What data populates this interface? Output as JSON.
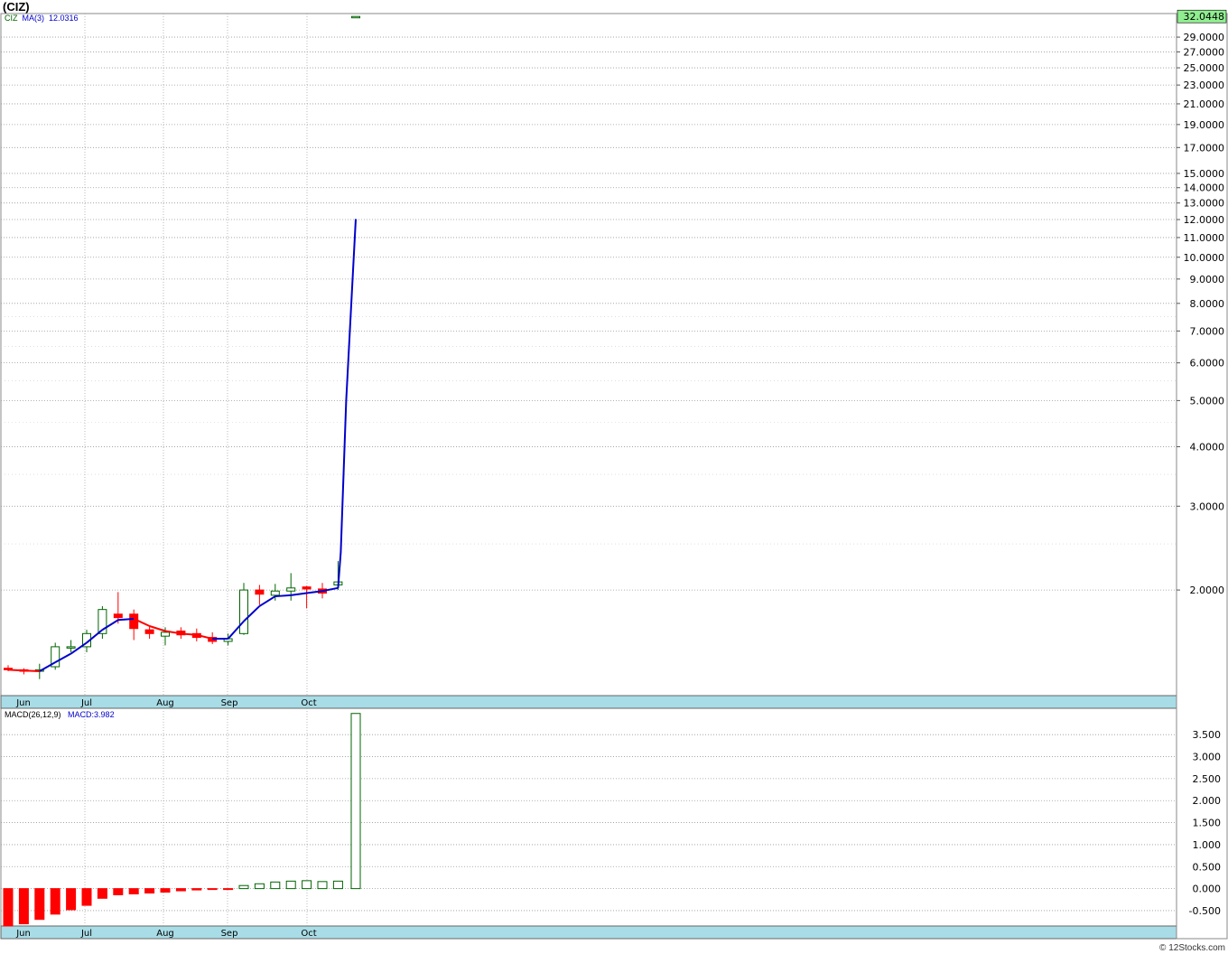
{
  "title": "(CIZ)",
  "credit": "© 12Stocks.com",
  "colors": {
    "up": "#006400",
    "down": "#ff0000",
    "ma_up": "#0000cc",
    "ma_down": "#ff0000",
    "axis_band": "#a8dce6",
    "last_price_bg": "#90ee90"
  },
  "chart_data": [
    {
      "type": "candlestick",
      "symbol": "CIZ",
      "scale": "log",
      "ylim": [
        1.2,
        32.5
      ],
      "x_labels": [
        "Jun",
        "Jul",
        "Aug",
        "Sep",
        "Oct"
      ],
      "y_ticks": [
        "29.0000",
        "27.0000",
        "25.0000",
        "23.0000",
        "21.0000",
        "19.0000",
        "17.0000",
        "15.0000",
        "14.0000",
        "13.0000",
        "12.0000",
        "11.0000",
        "10.0000",
        "9.0000",
        "8.0000",
        "7.0000",
        "6.0000",
        "5.0000",
        "4.0000",
        "3.0000",
        "2.0000"
      ],
      "last_price": "32.0448",
      "legend_symbol": "CIZ",
      "ma_label": "MA(3)",
      "ma_value": "12.0316",
      "candles": [
        {
          "o": 1.37,
          "h": 1.39,
          "l": 1.35,
          "c": 1.36
        },
        {
          "o": 1.36,
          "h": 1.37,
          "l": 1.33,
          "c": 1.35
        },
        {
          "o": 1.35,
          "h": 1.4,
          "l": 1.3,
          "c": 1.36
        },
        {
          "o": 1.38,
          "h": 1.55,
          "l": 1.36,
          "c": 1.52
        },
        {
          "o": 1.52,
          "h": 1.57,
          "l": 1.48,
          "c": 1.52
        },
        {
          "o": 1.52,
          "h": 1.65,
          "l": 1.48,
          "c": 1.62
        },
        {
          "o": 1.62,
          "h": 1.85,
          "l": 1.58,
          "c": 1.82
        },
        {
          "o": 1.78,
          "h": 1.98,
          "l": 1.7,
          "c": 1.75
        },
        {
          "o": 1.78,
          "h": 1.82,
          "l": 1.57,
          "c": 1.66
        },
        {
          "o": 1.65,
          "h": 1.68,
          "l": 1.58,
          "c": 1.62
        },
        {
          "o": 1.6,
          "h": 1.67,
          "l": 1.53,
          "c": 1.63
        },
        {
          "o": 1.64,
          "h": 1.67,
          "l": 1.58,
          "c": 1.61
        },
        {
          "o": 1.62,
          "h": 1.66,
          "l": 1.56,
          "c": 1.59
        },
        {
          "o": 1.59,
          "h": 1.63,
          "l": 1.54,
          "c": 1.56
        },
        {
          "o": 1.56,
          "h": 1.62,
          "l": 1.53,
          "c": 1.58
        },
        {
          "o": 1.62,
          "h": 2.07,
          "l": 1.61,
          "c": 2.0
        },
        {
          "o": 2.0,
          "h": 2.05,
          "l": 1.86,
          "c": 1.96
        },
        {
          "o": 1.95,
          "h": 2.06,
          "l": 1.9,
          "c": 1.99
        },
        {
          "o": 1.99,
          "h": 2.17,
          "l": 1.9,
          "c": 2.02
        },
        {
          "o": 2.03,
          "h": 2.04,
          "l": 1.83,
          "c": 2.01
        },
        {
          "o": 2.01,
          "h": 2.07,
          "l": 1.92,
          "c": 1.97
        },
        {
          "o": 2.05,
          "h": 2.3,
          "l": 2.0,
          "c": 2.08
        },
        {
          "o": 32.0,
          "h": 32.0448,
          "l": 31.9,
          "c": 32.0448
        }
      ],
      "ma": [
        1.36,
        1.355,
        1.35,
        1.41,
        1.47,
        1.55,
        1.65,
        1.73,
        1.74,
        1.68,
        1.64,
        1.62,
        1.61,
        1.58,
        1.58,
        1.72,
        1.85,
        1.94,
        1.95,
        1.97,
        1.99,
        2.02,
        12.0316
      ]
    },
    {
      "type": "bar",
      "indicator": "MACD",
      "label": "MACD(26,12,9)",
      "value_label": "MACD:3.982",
      "ylim": [
        -0.85,
        4.1
      ],
      "x_labels": [
        "Jun",
        "Jul",
        "Aug",
        "Sep",
        "Oct"
      ],
      "y_ticks": [
        "3.500",
        "3.000",
        "2.500",
        "2.000",
        "1.500",
        "1.000",
        "0.500",
        "0.000",
        "-0.500"
      ],
      "values": [
        -0.85,
        -0.8,
        -0.7,
        -0.58,
        -0.48,
        -0.38,
        -0.22,
        -0.14,
        -0.12,
        -0.1,
        -0.08,
        -0.05,
        -0.03,
        -0.01,
        -0.01,
        0.07,
        0.11,
        0.15,
        0.17,
        0.18,
        0.16,
        0.17,
        3.982
      ]
    }
  ]
}
